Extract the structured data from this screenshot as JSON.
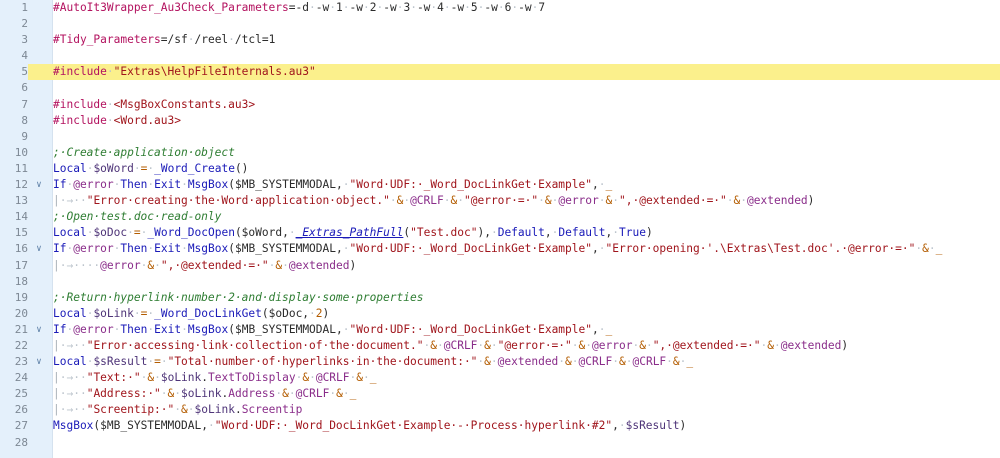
{
  "editor": {
    "highlight_color": "#fbf08c",
    "gutter_color": "#e4f0fb",
    "fold_icon": "chevron-down-icon",
    "lines": [
      {
        "n": "1",
        "fold": "",
        "hl": false,
        "toks": [
          [
            "d",
            "#AutoIt3Wrapper_Au3Check_Parameters"
          ],
          [
            "p",
            "="
          ],
          [
            "p",
            "-d"
          ],
          [
            "w",
            "·"
          ],
          [
            "p",
            "-w"
          ],
          [
            "w",
            "·"
          ],
          [
            "p",
            "1"
          ],
          [
            "w",
            "·"
          ],
          [
            "p",
            "-w"
          ],
          [
            "w",
            "·"
          ],
          [
            "p",
            "2"
          ],
          [
            "w",
            "·"
          ],
          [
            "p",
            "-w"
          ],
          [
            "w",
            "·"
          ],
          [
            "p",
            "3"
          ],
          [
            "w",
            "·"
          ],
          [
            "p",
            "-w"
          ],
          [
            "w",
            "·"
          ],
          [
            "p",
            "4"
          ],
          [
            "w",
            "·"
          ],
          [
            "p",
            "-w"
          ],
          [
            "w",
            "·"
          ],
          [
            "p",
            "5"
          ],
          [
            "w",
            "·"
          ],
          [
            "p",
            "-w"
          ],
          [
            "w",
            "·"
          ],
          [
            "p",
            "6"
          ],
          [
            "w",
            "·"
          ],
          [
            "p",
            "-w"
          ],
          [
            "w",
            "·"
          ],
          [
            "p",
            "7"
          ]
        ]
      },
      {
        "n": "2",
        "fold": "",
        "hl": false,
        "toks": []
      },
      {
        "n": "3",
        "fold": "",
        "hl": false,
        "toks": [
          [
            "d",
            "#Tidy_Parameters"
          ],
          [
            "p",
            "=/sf"
          ],
          [
            "w",
            "·"
          ],
          [
            "p",
            "/reel"
          ],
          [
            "w",
            "·"
          ],
          [
            "p",
            "/tcl=1"
          ]
        ]
      },
      {
        "n": "4",
        "fold": "",
        "hl": false,
        "toks": []
      },
      {
        "n": "5",
        "fold": "",
        "hl": true,
        "toks": [
          [
            "d",
            "#include"
          ],
          [
            "w",
            "·"
          ],
          [
            "s",
            "\"Extras\\HelpFileInternals.au3\""
          ]
        ]
      },
      {
        "n": "6",
        "fold": "",
        "hl": false,
        "toks": []
      },
      {
        "n": "7",
        "fold": "",
        "hl": false,
        "toks": [
          [
            "d",
            "#include"
          ],
          [
            "w",
            "·"
          ],
          [
            "s",
            "<MsgBoxConstants.au3>"
          ]
        ]
      },
      {
        "n": "8",
        "fold": "",
        "hl": false,
        "toks": [
          [
            "d",
            "#include"
          ],
          [
            "w",
            "·"
          ],
          [
            "s",
            "<Word.au3>"
          ]
        ]
      },
      {
        "n": "9",
        "fold": "",
        "hl": false,
        "toks": []
      },
      {
        "n": "10",
        "fold": "",
        "hl": false,
        "toks": [
          [
            "c",
            ";·Create·application·object"
          ]
        ]
      },
      {
        "n": "11",
        "fold": "",
        "hl": false,
        "toks": [
          [
            "k",
            "Local"
          ],
          [
            "w",
            "·"
          ],
          [
            "v",
            "$oWord"
          ],
          [
            "w",
            "·"
          ],
          [
            "o",
            "="
          ],
          [
            "w",
            "·"
          ],
          [
            "f",
            "_Word_Create"
          ],
          [
            "p",
            "()"
          ]
        ]
      },
      {
        "n": "12",
        "fold": "v",
        "hl": false,
        "toks": [
          [
            "k",
            "If"
          ],
          [
            "w",
            "·"
          ],
          [
            "m",
            "@error"
          ],
          [
            "w",
            "·"
          ],
          [
            "k",
            "Then"
          ],
          [
            "w",
            "·"
          ],
          [
            "k",
            "Exit"
          ],
          [
            "w",
            "·"
          ],
          [
            "f",
            "MsgBox"
          ],
          [
            "p",
            "($MB_SYSTEMMODAL,"
          ],
          [
            "w",
            "·"
          ],
          [
            "s",
            "\"Word·UDF:·_Word_DocLinkGet·Example\""
          ],
          [
            "p",
            ","
          ],
          [
            "w",
            "·"
          ],
          [
            "o",
            "_"
          ]
        ]
      },
      {
        "n": "13",
        "fold": "",
        "hl": false,
        "toks": [
          [
            "g",
            "|"
          ],
          [
            "w",
            "·→··"
          ],
          [
            "s",
            "\"Error·creating·the·Word·application·object.\""
          ],
          [
            "w",
            "·"
          ],
          [
            "o",
            "&"
          ],
          [
            "w",
            "·"
          ],
          [
            "m",
            "@CRLF"
          ],
          [
            "w",
            "·"
          ],
          [
            "o",
            "&"
          ],
          [
            "w",
            "·"
          ],
          [
            "s",
            "\"@error·=·\""
          ],
          [
            "w",
            "·"
          ],
          [
            "o",
            "&"
          ],
          [
            "w",
            "·"
          ],
          [
            "m",
            "@error"
          ],
          [
            "w",
            "·"
          ],
          [
            "o",
            "&"
          ],
          [
            "w",
            "·"
          ],
          [
            "s",
            "\",·@extended·=·\""
          ],
          [
            "w",
            "·"
          ],
          [
            "o",
            "&"
          ],
          [
            "w",
            "·"
          ],
          [
            "m",
            "@extended"
          ],
          [
            "p",
            ")"
          ]
        ]
      },
      {
        "n": "14",
        "fold": "",
        "hl": false,
        "toks": [
          [
            "c",
            ";·Open·test.doc·read-only"
          ]
        ]
      },
      {
        "n": "15",
        "fold": "",
        "hl": false,
        "toks": [
          [
            "k",
            "Local"
          ],
          [
            "w",
            "·"
          ],
          [
            "v",
            "$oDoc"
          ],
          [
            "w",
            "·"
          ],
          [
            "o",
            "="
          ],
          [
            "w",
            "·"
          ],
          [
            "f",
            "_Word_DocOpen"
          ],
          [
            "p",
            "($oWord,"
          ],
          [
            "w",
            "·"
          ],
          [
            "u",
            "_Extras_PathFull"
          ],
          [
            "p",
            "("
          ],
          [
            "s",
            "\"Test.doc\""
          ],
          [
            "p",
            "),"
          ],
          [
            "w",
            "·"
          ],
          [
            "k",
            "Default"
          ],
          [
            "p",
            ","
          ],
          [
            "w",
            "·"
          ],
          [
            "k",
            "Default"
          ],
          [
            "p",
            ","
          ],
          [
            "w",
            "·"
          ],
          [
            "k",
            "True"
          ],
          [
            "p",
            ")"
          ]
        ]
      },
      {
        "n": "16",
        "fold": "v",
        "hl": false,
        "toks": [
          [
            "k",
            "If"
          ],
          [
            "w",
            "·"
          ],
          [
            "m",
            "@error"
          ],
          [
            "w",
            "·"
          ],
          [
            "k",
            "Then"
          ],
          [
            "w",
            "·"
          ],
          [
            "k",
            "Exit"
          ],
          [
            "w",
            "·"
          ],
          [
            "f",
            "MsgBox"
          ],
          [
            "p",
            "($MB_SYSTEMMODAL,"
          ],
          [
            "w",
            "·"
          ],
          [
            "s",
            "\"Word·UDF:·_Word_DocLinkGet·Example\""
          ],
          [
            "p",
            ","
          ],
          [
            "w",
            "·"
          ],
          [
            "s",
            "\"Error·opening·'.\\Extras\\Test.doc'.·@error·=·\""
          ],
          [
            "w",
            "·"
          ],
          [
            "o",
            "&"
          ],
          [
            "w",
            "·"
          ],
          [
            "o",
            "_"
          ]
        ]
      },
      {
        "n": "17",
        "fold": "",
        "hl": false,
        "toks": [
          [
            "g",
            "|"
          ],
          [
            "w",
            "·→····"
          ],
          [
            "m",
            "@error"
          ],
          [
            "w",
            "·"
          ],
          [
            "o",
            "&"
          ],
          [
            "w",
            "·"
          ],
          [
            "s",
            "\",·@extended·=·\""
          ],
          [
            "w",
            "·"
          ],
          [
            "o",
            "&"
          ],
          [
            "w",
            "·"
          ],
          [
            "m",
            "@extended"
          ],
          [
            "p",
            ")"
          ]
        ]
      },
      {
        "n": "18",
        "fold": "",
        "hl": false,
        "toks": []
      },
      {
        "n": "19",
        "fold": "",
        "hl": false,
        "toks": [
          [
            "c",
            ";·Return·hyperlink·number·2·and·display·some·properties"
          ]
        ]
      },
      {
        "n": "20",
        "fold": "",
        "hl": false,
        "toks": [
          [
            "k",
            "Local"
          ],
          [
            "w",
            "·"
          ],
          [
            "v",
            "$oLink"
          ],
          [
            "w",
            "·"
          ],
          [
            "o",
            "="
          ],
          [
            "w",
            "·"
          ],
          [
            "f",
            "_Word_DocLinkGet"
          ],
          [
            "p",
            "($oDoc,"
          ],
          [
            "w",
            "·"
          ],
          [
            "n",
            "2"
          ],
          [
            "p",
            ")"
          ]
        ]
      },
      {
        "n": "21",
        "fold": "v",
        "hl": false,
        "toks": [
          [
            "k",
            "If"
          ],
          [
            "w",
            "·"
          ],
          [
            "m",
            "@error"
          ],
          [
            "w",
            "·"
          ],
          [
            "k",
            "Then"
          ],
          [
            "w",
            "·"
          ],
          [
            "k",
            "Exit"
          ],
          [
            "w",
            "·"
          ],
          [
            "f",
            "MsgBox"
          ],
          [
            "p",
            "($MB_SYSTEMMODAL,"
          ],
          [
            "w",
            "·"
          ],
          [
            "s",
            "\"Word·UDF:·_Word_DocLinkGet·Example\""
          ],
          [
            "p",
            ","
          ],
          [
            "w",
            "·"
          ],
          [
            "o",
            "_"
          ]
        ]
      },
      {
        "n": "22",
        "fold": "",
        "hl": false,
        "toks": [
          [
            "g",
            "|"
          ],
          [
            "w",
            "·→··"
          ],
          [
            "s",
            "\"Error·accessing·link·collection·of·the·document.\""
          ],
          [
            "w",
            "·"
          ],
          [
            "o",
            "&"
          ],
          [
            "w",
            "·"
          ],
          [
            "m",
            "@CRLF"
          ],
          [
            "w",
            "·"
          ],
          [
            "o",
            "&"
          ],
          [
            "w",
            "·"
          ],
          [
            "s",
            "\"@error·=·\""
          ],
          [
            "w",
            "·"
          ],
          [
            "o",
            "&"
          ],
          [
            "w",
            "·"
          ],
          [
            "m",
            "@error"
          ],
          [
            "w",
            "·"
          ],
          [
            "o",
            "&"
          ],
          [
            "w",
            "·"
          ],
          [
            "s",
            "\",·@extended·=·\""
          ],
          [
            "w",
            "·"
          ],
          [
            "o",
            "&"
          ],
          [
            "w",
            "·"
          ],
          [
            "m",
            "@extended"
          ],
          [
            "p",
            ")"
          ]
        ]
      },
      {
        "n": "23",
        "fold": "v",
        "hl": false,
        "toks": [
          [
            "k",
            "Local"
          ],
          [
            "w",
            "·"
          ],
          [
            "v",
            "$sResult"
          ],
          [
            "w",
            "·"
          ],
          [
            "o",
            "="
          ],
          [
            "w",
            "·"
          ],
          [
            "s",
            "\"Total·number·of·hyperlinks·in·the·document:·\""
          ],
          [
            "w",
            "·"
          ],
          [
            "o",
            "&"
          ],
          [
            "w",
            "·"
          ],
          [
            "m",
            "@extended"
          ],
          [
            "w",
            "·"
          ],
          [
            "o",
            "&"
          ],
          [
            "w",
            "·"
          ],
          [
            "m",
            "@CRLF"
          ],
          [
            "w",
            "·"
          ],
          [
            "o",
            "&"
          ],
          [
            "w",
            "·"
          ],
          [
            "m",
            "@CRLF"
          ],
          [
            "w",
            "·"
          ],
          [
            "o",
            "&"
          ],
          [
            "w",
            "·"
          ],
          [
            "o",
            "_"
          ]
        ]
      },
      {
        "n": "24",
        "fold": "",
        "hl": false,
        "toks": [
          [
            "g",
            "|"
          ],
          [
            "w",
            "·→··"
          ],
          [
            "s",
            "\"Text:·\""
          ],
          [
            "w",
            "·"
          ],
          [
            "o",
            "&"
          ],
          [
            "w",
            "·"
          ],
          [
            "v",
            "$oLink"
          ],
          [
            "p",
            "."
          ],
          [
            "m",
            "TextToDisplay"
          ],
          [
            "w",
            "·"
          ],
          [
            "o",
            "&"
          ],
          [
            "w",
            "·"
          ],
          [
            "m",
            "@CRLF"
          ],
          [
            "w",
            "·"
          ],
          [
            "o",
            "&"
          ],
          [
            "w",
            "·"
          ],
          [
            "o",
            "_"
          ]
        ]
      },
      {
        "n": "25",
        "fold": "",
        "hl": false,
        "toks": [
          [
            "g",
            "|"
          ],
          [
            "w",
            "·→··"
          ],
          [
            "s",
            "\"Address:·\""
          ],
          [
            "w",
            "·"
          ],
          [
            "o",
            "&"
          ],
          [
            "w",
            "·"
          ],
          [
            "v",
            "$oLink"
          ],
          [
            "p",
            "."
          ],
          [
            "m",
            "Address"
          ],
          [
            "w",
            "·"
          ],
          [
            "o",
            "&"
          ],
          [
            "w",
            "·"
          ],
          [
            "m",
            "@CRLF"
          ],
          [
            "w",
            "·"
          ],
          [
            "o",
            "&"
          ],
          [
            "w",
            "·"
          ],
          [
            "o",
            "_"
          ]
        ]
      },
      {
        "n": "26",
        "fold": "",
        "hl": false,
        "toks": [
          [
            "g",
            "|"
          ],
          [
            "w",
            "·→··"
          ],
          [
            "s",
            "\"Screentip:·\""
          ],
          [
            "w",
            "·"
          ],
          [
            "o",
            "&"
          ],
          [
            "w",
            "·"
          ],
          [
            "v",
            "$oLink"
          ],
          [
            "p",
            "."
          ],
          [
            "m",
            "Screentip"
          ]
        ]
      },
      {
        "n": "27",
        "fold": "",
        "hl": false,
        "toks": [
          [
            "f",
            "MsgBox"
          ],
          [
            "p",
            "($MB_SYSTEMMODAL,"
          ],
          [
            "w",
            "·"
          ],
          [
            "s",
            "\"Word·UDF:·_Word_DocLinkGet·Example·-·Process·hyperlink·#2\""
          ],
          [
            "p",
            ","
          ],
          [
            "w",
            "·"
          ],
          [
            "v",
            "$sResult"
          ],
          [
            "p",
            ")"
          ]
        ]
      },
      {
        "n": "28",
        "fold": "",
        "hl": false,
        "toks": []
      }
    ]
  }
}
